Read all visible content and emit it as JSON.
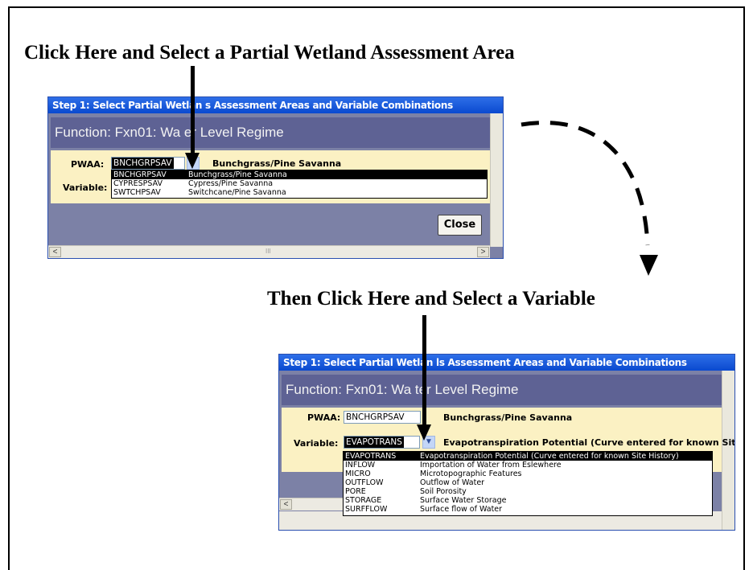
{
  "instruction_top": "Click Here and Select a Partial Wetland Assessment Area",
  "instruction_bottom": "Then Click Here and Select a Variable",
  "dialog1": {
    "title": "Step 1: Select Partial Wetlan s Assessment Areas and Variable Combinations",
    "function_label": "Function:  Fxn01:  Wa er Level Regime",
    "pwaa_label": "PWAA:",
    "pwaa_value": "BNCHGRPSAV",
    "pwaa_desc": "Bunchgrass/Pine Savanna",
    "variable_label": "Variable:",
    "dropdown_options": [
      {
        "code": "BNCHGRPSAV",
        "desc": "Bunchgrass/Pine Savanna",
        "selected": true
      },
      {
        "code": "CYPRESPSAV",
        "desc": "Cypress/Pine Savanna",
        "selected": false
      },
      {
        "code": "SWTCHPSAV",
        "desc": "Switchcane/Pine Savanna",
        "selected": false
      }
    ],
    "close_label": "Close",
    "scroll_left": "<",
    "scroll_right": ">",
    "scroll_thumb": "III"
  },
  "dialog2": {
    "title": "Step 1: Select Partial Wetlan ls Assessment Areas and Variable Combinations",
    "function_label": "Function:  Fxn01:  Wa ter Level Regime",
    "pwaa_label": "PWAA:",
    "pwaa_value": "BNCHGRPSAV",
    "pwaa_desc": "Bunchgrass/Pine Savanna",
    "variable_label": "Variable:",
    "variable_value": "EVAPOTRANS",
    "variable_desc": "Evapotranspiration Potential (Curve entered for known Site",
    "dropdown_options": [
      {
        "code": "EVAPOTRANS",
        "desc": "Evapotranspiration Potential (Curve entered for known Site History)",
        "selected": true
      },
      {
        "code": "INFLOW",
        "desc": "Importation of Water from Eslewhere",
        "selected": false
      },
      {
        "code": "MICRO",
        "desc": "Microtopographic Features",
        "selected": false
      },
      {
        "code": "OUTFLOW",
        "desc": "Outflow of Water",
        "selected": false
      },
      {
        "code": "PORE",
        "desc": "Soil Porosity",
        "selected": false
      },
      {
        "code": "STORAGE",
        "desc": "Surface Water Storage",
        "selected": false
      },
      {
        "code": "SURFFLOW",
        "desc": "Surface flow of Water",
        "selected": false
      }
    ],
    "scroll_left": "<"
  },
  "icons": {
    "dropdown": "chevron-down-icon",
    "pointer_arrow": "arrow-down-icon",
    "curved_arrow": "dashed-curved-arrow-icon"
  },
  "colors": {
    "title_bar": "#0a49cf",
    "function_bar": "#5e6294",
    "panel": "#fbf1c3",
    "dialog_bg": "#7c81a6"
  }
}
